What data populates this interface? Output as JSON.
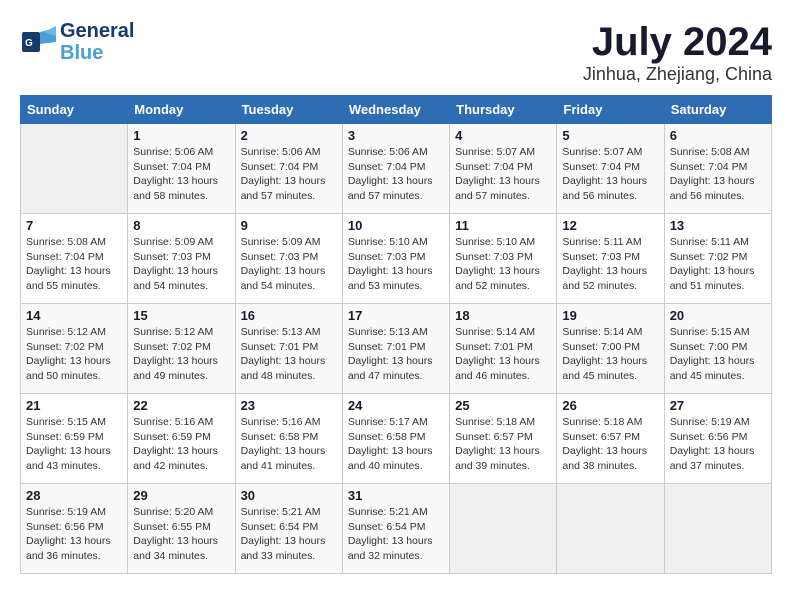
{
  "header": {
    "logo_line1": "General",
    "logo_line2": "Blue",
    "month": "July 2024",
    "location": "Jinhua, Zhejiang, China"
  },
  "columns": [
    "Sunday",
    "Monday",
    "Tuesday",
    "Wednesday",
    "Thursday",
    "Friday",
    "Saturday"
  ],
  "weeks": [
    [
      {
        "day": "",
        "info": ""
      },
      {
        "day": "1",
        "info": "Sunrise: 5:06 AM\nSunset: 7:04 PM\nDaylight: 13 hours\nand 58 minutes."
      },
      {
        "day": "2",
        "info": "Sunrise: 5:06 AM\nSunset: 7:04 PM\nDaylight: 13 hours\nand 57 minutes."
      },
      {
        "day": "3",
        "info": "Sunrise: 5:06 AM\nSunset: 7:04 PM\nDaylight: 13 hours\nand 57 minutes."
      },
      {
        "day": "4",
        "info": "Sunrise: 5:07 AM\nSunset: 7:04 PM\nDaylight: 13 hours\nand 57 minutes."
      },
      {
        "day": "5",
        "info": "Sunrise: 5:07 AM\nSunset: 7:04 PM\nDaylight: 13 hours\nand 56 minutes."
      },
      {
        "day": "6",
        "info": "Sunrise: 5:08 AM\nSunset: 7:04 PM\nDaylight: 13 hours\nand 56 minutes."
      }
    ],
    [
      {
        "day": "7",
        "info": "Sunrise: 5:08 AM\nSunset: 7:04 PM\nDaylight: 13 hours\nand 55 minutes."
      },
      {
        "day": "8",
        "info": "Sunrise: 5:09 AM\nSunset: 7:03 PM\nDaylight: 13 hours\nand 54 minutes."
      },
      {
        "day": "9",
        "info": "Sunrise: 5:09 AM\nSunset: 7:03 PM\nDaylight: 13 hours\nand 54 minutes."
      },
      {
        "day": "10",
        "info": "Sunrise: 5:10 AM\nSunset: 7:03 PM\nDaylight: 13 hours\nand 53 minutes."
      },
      {
        "day": "11",
        "info": "Sunrise: 5:10 AM\nSunset: 7:03 PM\nDaylight: 13 hours\nand 52 minutes."
      },
      {
        "day": "12",
        "info": "Sunrise: 5:11 AM\nSunset: 7:03 PM\nDaylight: 13 hours\nand 52 minutes."
      },
      {
        "day": "13",
        "info": "Sunrise: 5:11 AM\nSunset: 7:02 PM\nDaylight: 13 hours\nand 51 minutes."
      }
    ],
    [
      {
        "day": "14",
        "info": "Sunrise: 5:12 AM\nSunset: 7:02 PM\nDaylight: 13 hours\nand 50 minutes."
      },
      {
        "day": "15",
        "info": "Sunrise: 5:12 AM\nSunset: 7:02 PM\nDaylight: 13 hours\nand 49 minutes."
      },
      {
        "day": "16",
        "info": "Sunrise: 5:13 AM\nSunset: 7:01 PM\nDaylight: 13 hours\nand 48 minutes."
      },
      {
        "day": "17",
        "info": "Sunrise: 5:13 AM\nSunset: 7:01 PM\nDaylight: 13 hours\nand 47 minutes."
      },
      {
        "day": "18",
        "info": "Sunrise: 5:14 AM\nSunset: 7:01 PM\nDaylight: 13 hours\nand 46 minutes."
      },
      {
        "day": "19",
        "info": "Sunrise: 5:14 AM\nSunset: 7:00 PM\nDaylight: 13 hours\nand 45 minutes."
      },
      {
        "day": "20",
        "info": "Sunrise: 5:15 AM\nSunset: 7:00 PM\nDaylight: 13 hours\nand 45 minutes."
      }
    ],
    [
      {
        "day": "21",
        "info": "Sunrise: 5:15 AM\nSunset: 6:59 PM\nDaylight: 13 hours\nand 43 minutes."
      },
      {
        "day": "22",
        "info": "Sunrise: 5:16 AM\nSunset: 6:59 PM\nDaylight: 13 hours\nand 42 minutes."
      },
      {
        "day": "23",
        "info": "Sunrise: 5:16 AM\nSunset: 6:58 PM\nDaylight: 13 hours\nand 41 minutes."
      },
      {
        "day": "24",
        "info": "Sunrise: 5:17 AM\nSunset: 6:58 PM\nDaylight: 13 hours\nand 40 minutes."
      },
      {
        "day": "25",
        "info": "Sunrise: 5:18 AM\nSunset: 6:57 PM\nDaylight: 13 hours\nand 39 minutes."
      },
      {
        "day": "26",
        "info": "Sunrise: 5:18 AM\nSunset: 6:57 PM\nDaylight: 13 hours\nand 38 minutes."
      },
      {
        "day": "27",
        "info": "Sunrise: 5:19 AM\nSunset: 6:56 PM\nDaylight: 13 hours\nand 37 minutes."
      }
    ],
    [
      {
        "day": "28",
        "info": "Sunrise: 5:19 AM\nSunset: 6:56 PM\nDaylight: 13 hours\nand 36 minutes."
      },
      {
        "day": "29",
        "info": "Sunrise: 5:20 AM\nSunset: 6:55 PM\nDaylight: 13 hours\nand 34 minutes."
      },
      {
        "day": "30",
        "info": "Sunrise: 5:21 AM\nSunset: 6:54 PM\nDaylight: 13 hours\nand 33 minutes."
      },
      {
        "day": "31",
        "info": "Sunrise: 5:21 AM\nSunset: 6:54 PM\nDaylight: 13 hours\nand 32 minutes."
      },
      {
        "day": "",
        "info": ""
      },
      {
        "day": "",
        "info": ""
      },
      {
        "day": "",
        "info": ""
      }
    ]
  ]
}
